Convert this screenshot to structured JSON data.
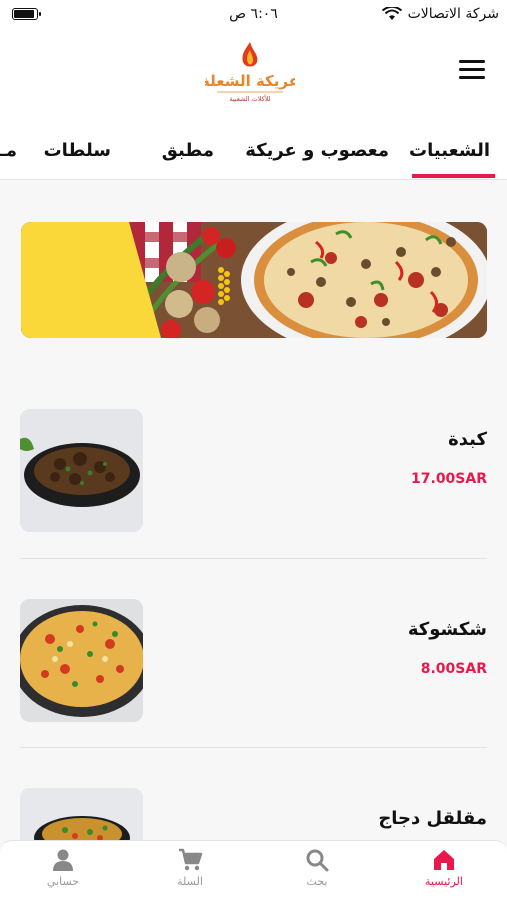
{
  "status_bar": {
    "carrier": "شركة الاتصالات",
    "time": "٦:٠٦ ص"
  },
  "header": {
    "logo_text": "عريكة الشعلة",
    "logo_subtext": "للأكلات الشعبية"
  },
  "tabs": [
    {
      "label": "الشعبيات",
      "active": true
    },
    {
      "label": "معصوب و عريكة",
      "active": false
    },
    {
      "label": "مطبق",
      "active": false
    },
    {
      "label": "سلطات",
      "active": false
    },
    {
      "label": "مـ",
      "active": false
    }
  ],
  "products": [
    {
      "name": "كبدة",
      "price": "17.00SAR"
    },
    {
      "name": "شكشوكة",
      "price": "8.00SAR"
    },
    {
      "name": "مقلقل دجاج",
      "price": ""
    }
  ],
  "bottom_nav": [
    {
      "label": "الرئيسية",
      "icon": "home-icon",
      "active": true
    },
    {
      "label": "بحث",
      "icon": "search-icon",
      "active": false
    },
    {
      "label": "السلة",
      "icon": "cart-icon",
      "active": false
    },
    {
      "label": "حسابي",
      "icon": "user-icon",
      "active": false
    }
  ],
  "colors": {
    "accent": "#e8194b",
    "logo_orange": "#e8862a",
    "banner_yellow": "#fbd83a"
  }
}
